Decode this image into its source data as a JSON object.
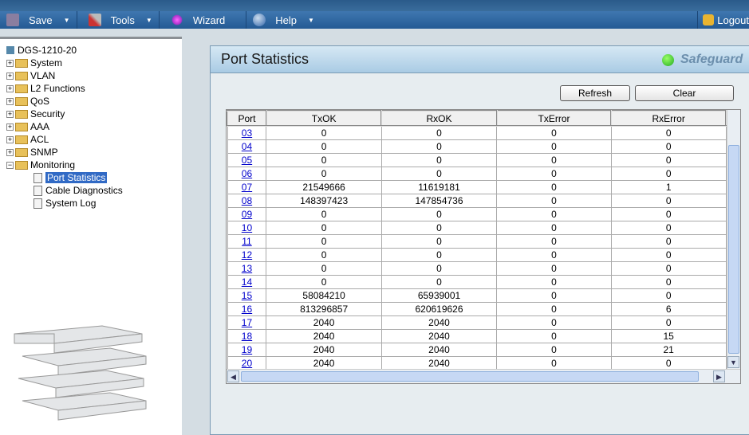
{
  "menu": {
    "save": "Save",
    "tools": "Tools",
    "wizard": "Wizard",
    "help": "Help",
    "logout": "Logout"
  },
  "tree": {
    "root": "DGS-1210-20",
    "items": [
      "System",
      "VLAN",
      "L2 Functions",
      "QoS",
      "Security",
      "AAA",
      "ACL",
      "SNMP",
      "Monitoring"
    ],
    "children": [
      "Port Statistics",
      "Cable Diagnostics",
      "System Log"
    ]
  },
  "panel": {
    "title": "Port Statistics",
    "safeguard": "Safeguard",
    "refresh": "Refresh",
    "clear": "Clear"
  },
  "table": {
    "headers": [
      "Port",
      "TxOK",
      "RxOK",
      "TxError",
      "RxError"
    ],
    "rows": [
      [
        "03",
        "0",
        "0",
        "0",
        "0"
      ],
      [
        "04",
        "0",
        "0",
        "0",
        "0"
      ],
      [
        "05",
        "0",
        "0",
        "0",
        "0"
      ],
      [
        "06",
        "0",
        "0",
        "0",
        "0"
      ],
      [
        "07",
        "21549666",
        "11619181",
        "0",
        "1"
      ],
      [
        "08",
        "148397423",
        "147854736",
        "0",
        "0"
      ],
      [
        "09",
        "0",
        "0",
        "0",
        "0"
      ],
      [
        "10",
        "0",
        "0",
        "0",
        "0"
      ],
      [
        "11",
        "0",
        "0",
        "0",
        "0"
      ],
      [
        "12",
        "0",
        "0",
        "0",
        "0"
      ],
      [
        "13",
        "0",
        "0",
        "0",
        "0"
      ],
      [
        "14",
        "0",
        "0",
        "0",
        "0"
      ],
      [
        "15",
        "58084210",
        "65939001",
        "0",
        "0"
      ],
      [
        "16",
        "813296857",
        "620619626",
        "0",
        "6"
      ],
      [
        "17",
        "2040",
        "2040",
        "0",
        "0"
      ],
      [
        "18",
        "2040",
        "2040",
        "0",
        "15"
      ],
      [
        "19",
        "2040",
        "2040",
        "0",
        "21"
      ],
      [
        "20",
        "2040",
        "2040",
        "0",
        "0"
      ]
    ]
  }
}
